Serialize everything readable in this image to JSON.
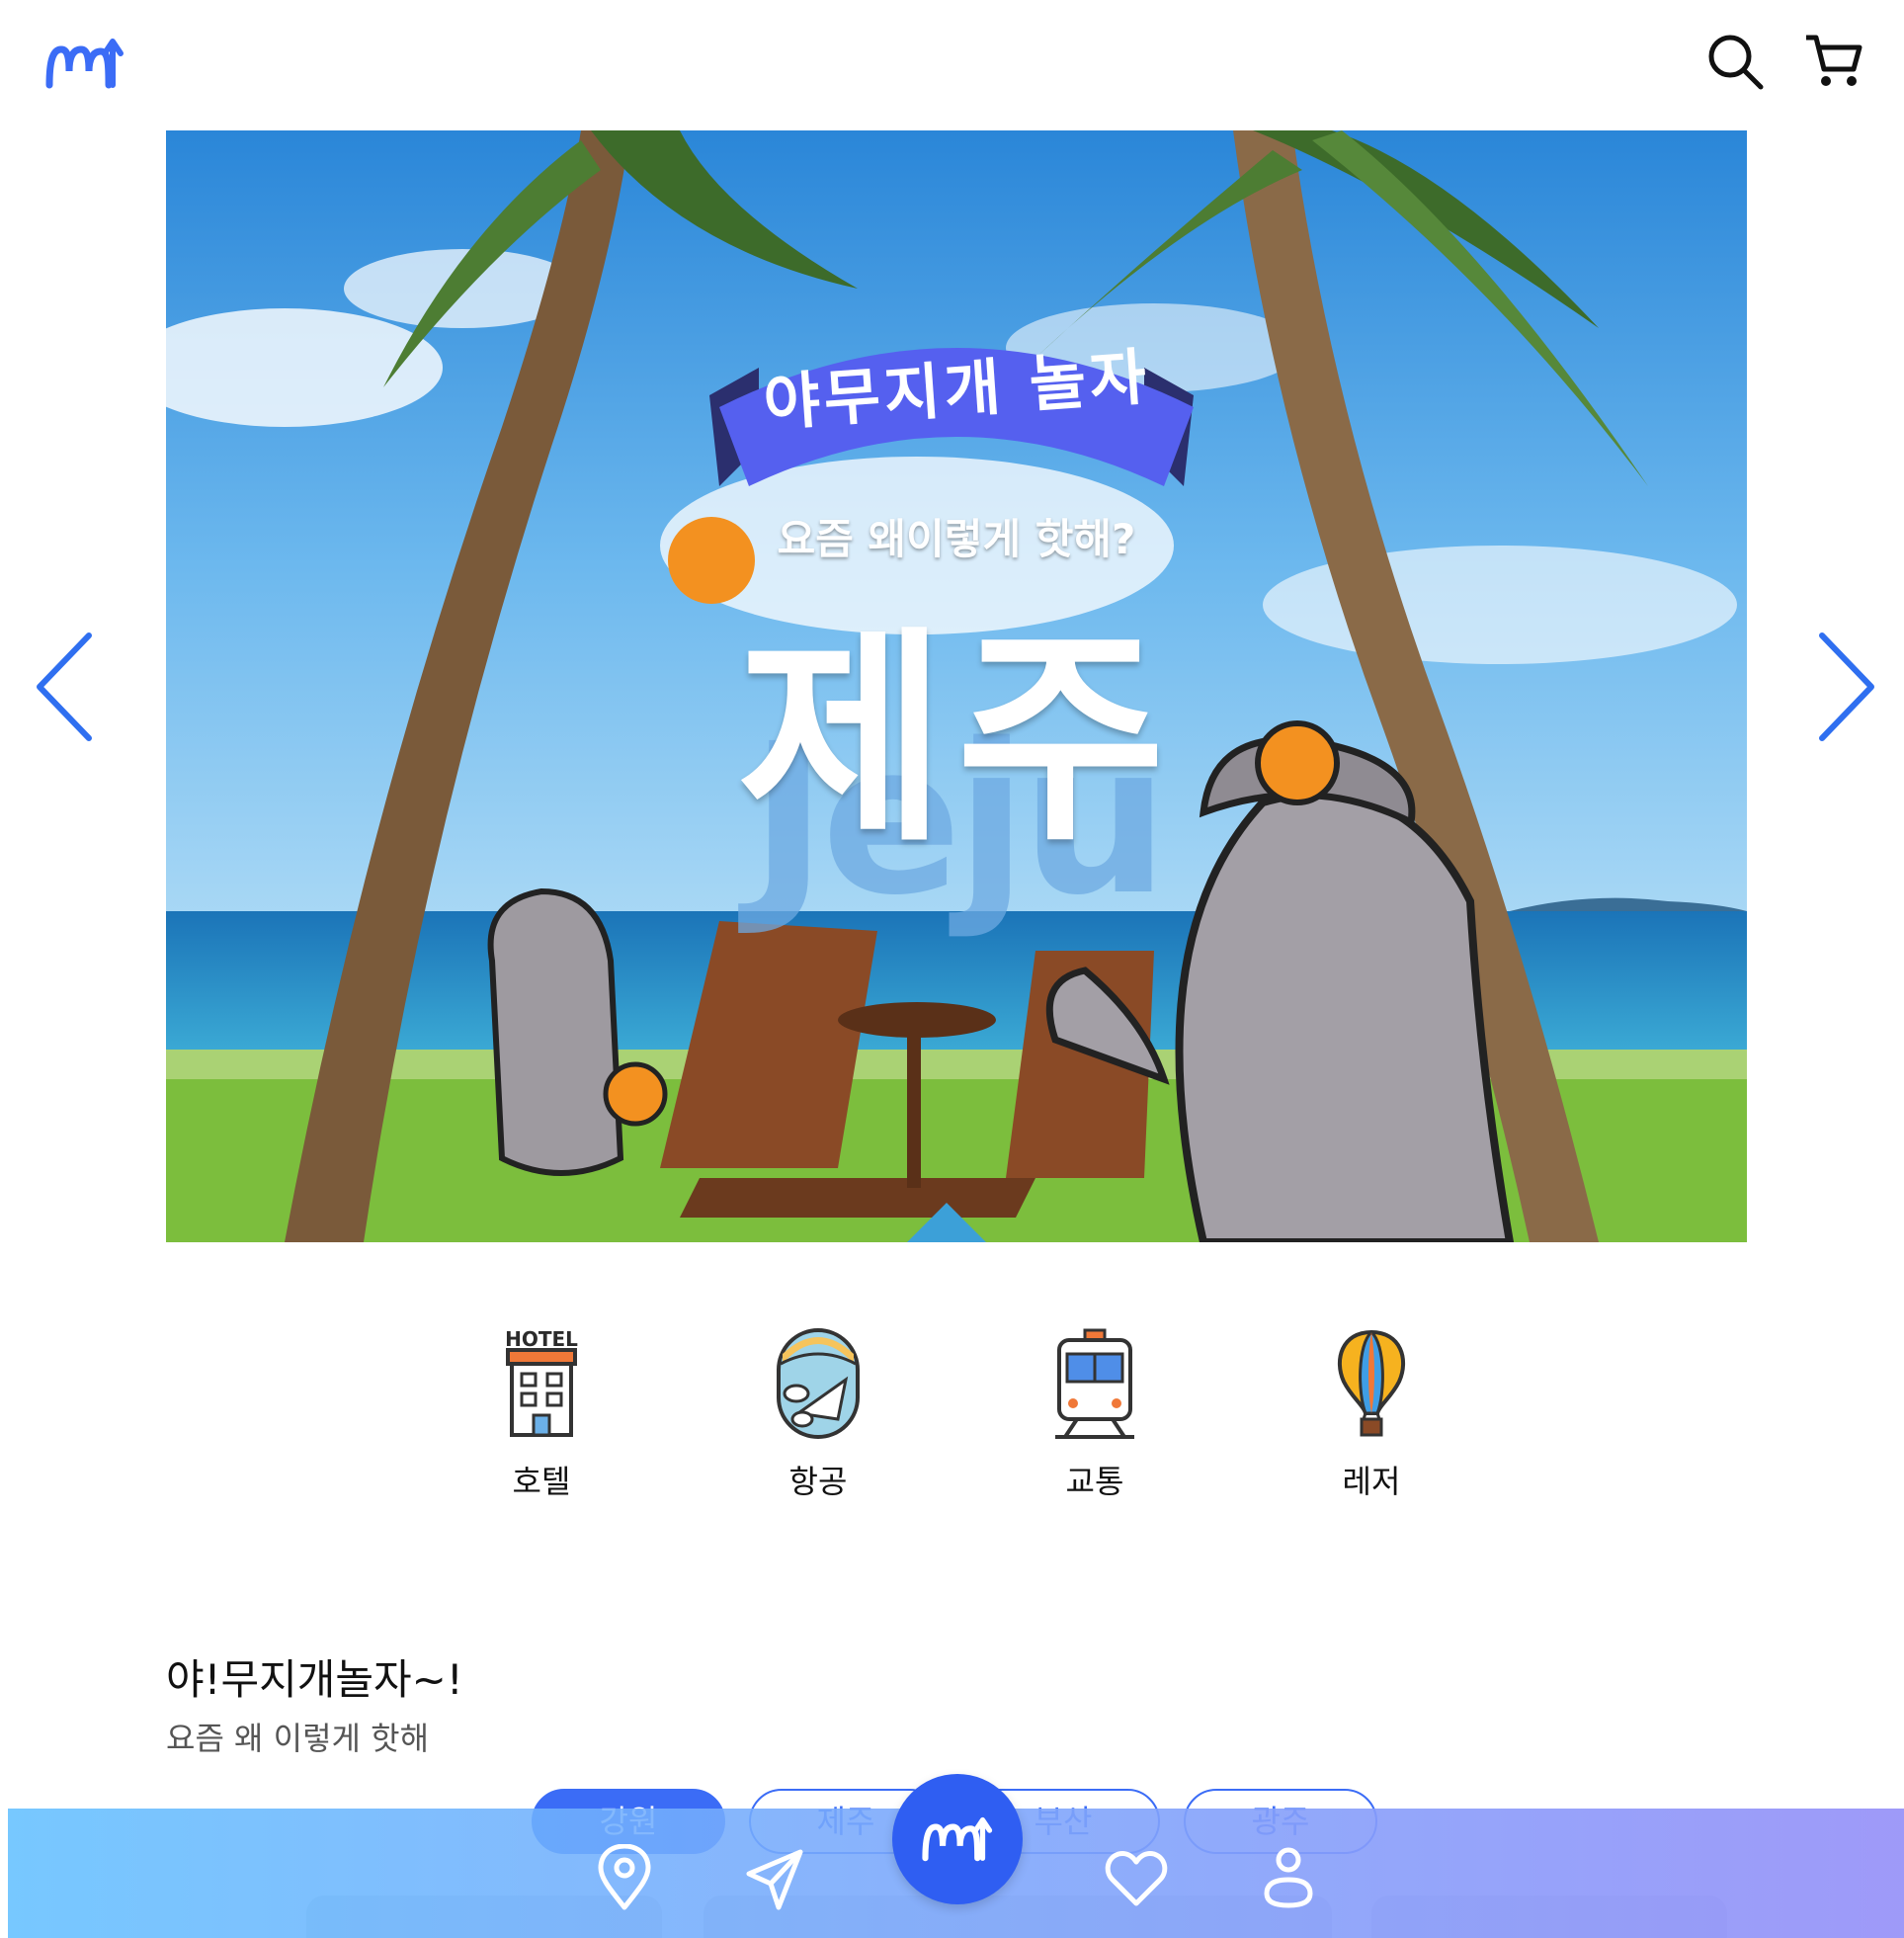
{
  "header": {
    "logo_icon": "rainbow-m-logo",
    "search_icon": "search-icon",
    "cart_icon": "cart-icon"
  },
  "hero": {
    "ribbon_text": "야무지개 놀자",
    "subtitle": "요즘 왜이렇게 핫해?",
    "title": "제주",
    "watermark": "Jeju",
    "prev_icon": "chevron-left-icon",
    "next_icon": "chevron-right-icon"
  },
  "categories": [
    {
      "label": "호텔",
      "icon": "hotel-icon",
      "icon_text": "HOTEL"
    },
    {
      "label": "항공",
      "icon": "airplane-window-icon"
    },
    {
      "label": "교통",
      "icon": "train-icon"
    },
    {
      "label": "레저",
      "icon": "hot-air-balloon-icon"
    }
  ],
  "section": {
    "title": "야!무지개놀자~!",
    "subtitle": "요즘 왜 이렇게 핫해",
    "chips": [
      {
        "label": "강원",
        "active": true
      },
      {
        "label": "제주",
        "active": false
      },
      {
        "label": "부산",
        "active": false
      },
      {
        "label": "광주",
        "active": false
      }
    ]
  },
  "bottom_nav": {
    "items": [
      "location-pin-icon",
      "send-icon",
      "home-logo-icon",
      "heart-icon",
      "user-icon"
    ]
  },
  "colors": {
    "brand": "#3b6cf6",
    "fab": "#2f5ef2",
    "nav_gradient_start": "#5fbeff",
    "nav_gradient_end": "#9691f8"
  }
}
